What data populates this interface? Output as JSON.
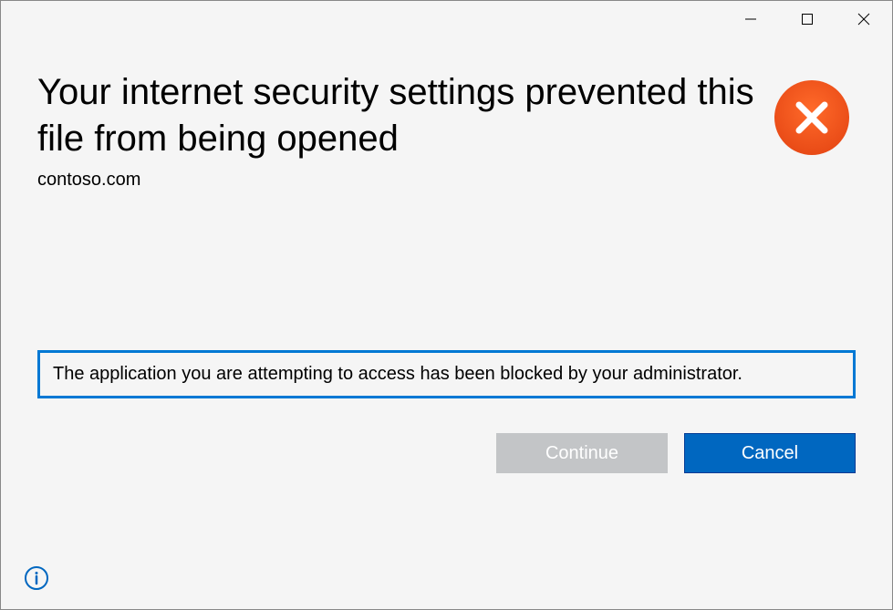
{
  "title": "Your internet security settings prevented this file from being opened",
  "subtitle": "contoso.com",
  "message": "The application you are attempting to access has been blocked by your administrator.",
  "buttons": {
    "continue_label": "Continue",
    "cancel_label": "Cancel"
  }
}
